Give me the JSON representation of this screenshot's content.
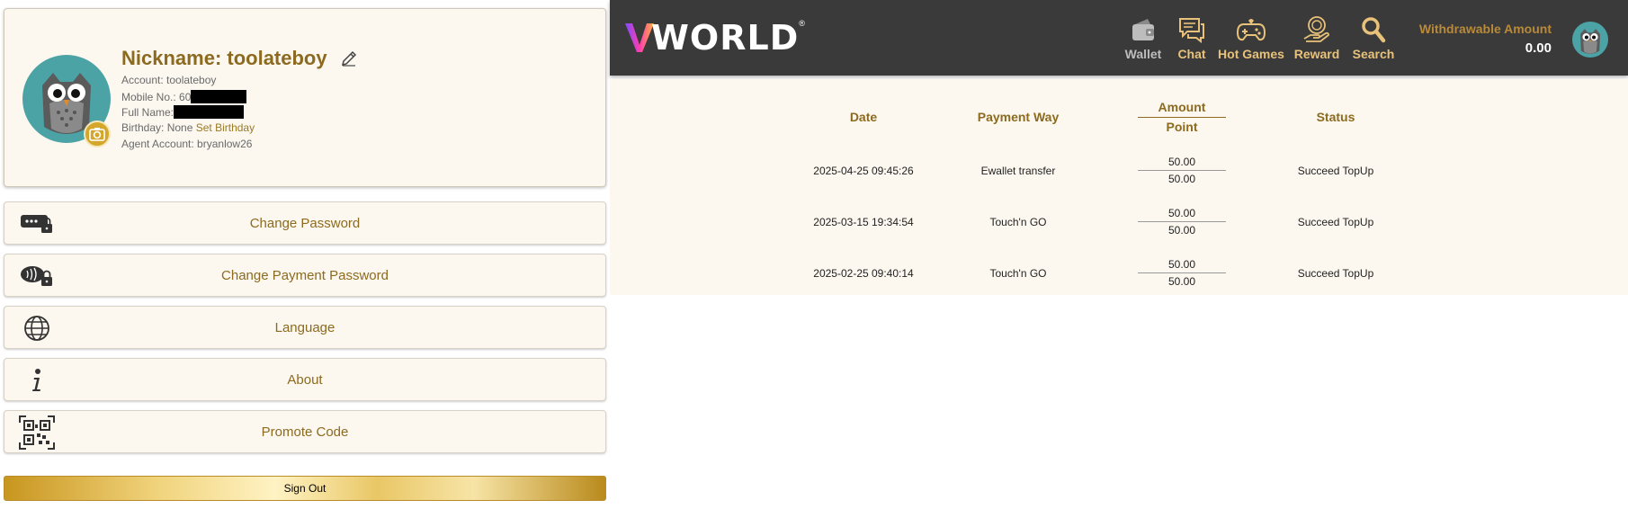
{
  "profile": {
    "nickname": "Nickname: toolateboy",
    "account": "Account: toolateboy",
    "mobile_label": "Mobile No.: 60",
    "fullname_label": "Full Name:",
    "birthday_label": "Birthday: None",
    "set_birthday": "Set Birthday",
    "agent": "Agent Account: bryanlow26"
  },
  "menu": [
    {
      "label": "Change Password",
      "icon": "password-lock-icon"
    },
    {
      "label": "Change Payment Password",
      "icon": "payment-lock-icon"
    },
    {
      "label": "Language",
      "icon": "globe-icon"
    },
    {
      "label": "About",
      "icon": "info-icon"
    },
    {
      "label": "Promote Code",
      "icon": "qr-code-icon"
    }
  ],
  "sign_out": "Sign Out",
  "header": {
    "logo": "WORLD",
    "logo_reg": "®",
    "nav": [
      {
        "label": "Wallet",
        "icon": "wallet-icon"
      },
      {
        "label": "Chat",
        "icon": "chat-icon"
      },
      {
        "label": "Hot Games",
        "icon": "gamepad-icon"
      },
      {
        "label": "Reward",
        "icon": "reward-icon"
      },
      {
        "label": "Search",
        "icon": "search-icon"
      }
    ],
    "withdrawable_label": "Withdrawable Amount",
    "withdrawable_amount": "0.00"
  },
  "table": {
    "headers": {
      "date": "Date",
      "payment_way": "Payment Way",
      "amount": "Amount",
      "point": "Point",
      "status": "Status"
    },
    "rows": [
      {
        "date": "2025-04-25 09:45:26",
        "payment_way": "Ewallet transfer",
        "amount": "50.00",
        "point": "50.00",
        "status": "Succeed TopUp"
      },
      {
        "date": "2025-03-15 19:34:54",
        "payment_way": "Touch'n GO",
        "amount": "50.00",
        "point": "50.00",
        "status": "Succeed TopUp"
      },
      {
        "date": "2025-02-25 09:40:14",
        "payment_way": "Touch'n GO",
        "amount": "50.00",
        "point": "50.00",
        "status": "Succeed TopUp"
      }
    ]
  },
  "colors": {
    "gold": "#8c6a1f",
    "header_bg": "#3a3a3a",
    "panel_bg": "#fcf8ef",
    "avatar_teal": "#4ba3a6"
  }
}
